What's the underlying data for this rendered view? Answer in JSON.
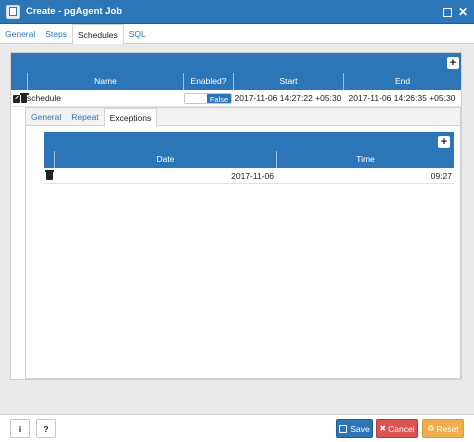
{
  "window": {
    "title": "Create - pgAgent Job",
    "app_icon": "database-icon"
  },
  "tabs": [
    {
      "label": "General",
      "active": false
    },
    {
      "label": "Steps",
      "active": false
    },
    {
      "label": "Schedules",
      "active": true
    },
    {
      "label": "SQL",
      "active": false
    }
  ],
  "schedules": {
    "add_label": "+",
    "columns": [
      "Name",
      "Enabled?",
      "Start",
      "End"
    ],
    "rows": [
      {
        "name": "schedule",
        "enabled": "False",
        "start": "2017-11-06 14:27:22 +05:30",
        "end": "2017-11-06 14:26:35 +05:30"
      }
    ],
    "subtabs": [
      {
        "label": "General",
        "active": false
      },
      {
        "label": "Repeat",
        "active": false
      },
      {
        "label": "Exceptions",
        "active": true
      }
    ],
    "exceptions": {
      "add_label": "+",
      "columns": [
        "Date",
        "Time"
      ],
      "rows": [
        {
          "date": "2017-11-06",
          "time": "09:27"
        }
      ]
    }
  },
  "footer": {
    "info_label": "i",
    "help_label": "?",
    "save_label": "Save",
    "cancel_label": "Cancel",
    "reset_label": "Reset"
  },
  "colors": {
    "accent": "#2c76b8",
    "danger": "#d9534f",
    "warning": "#f0ad4e"
  }
}
